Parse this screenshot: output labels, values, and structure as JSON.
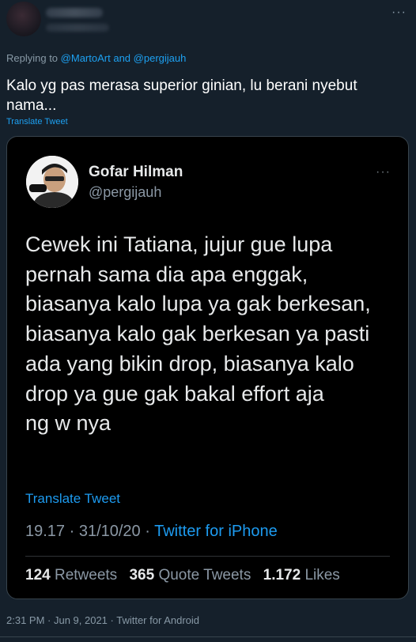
{
  "reply": {
    "replying_prefix": "Replying to",
    "mention_1": "@MartoArt",
    "and_word": "and",
    "mention_2": "@pergijauh",
    "text": "Kalo yg pas merasa superior ginian, lu berani nyebut nama...",
    "translate_label": "Translate Tweet",
    "timestamp": "2:31 PM · Jun 9, 2021 · Twitter for Android",
    "more_icon": "more-horizontal-icon"
  },
  "embedded": {
    "name": "Gofar Hilman",
    "handle": "@pergijauh",
    "text": "Cewek ini Tatiana, jujur gue lupa\npernah sama dia apa enggak,\nbiasanya kalo lupa ya gak berkesan,\nbiasanya kalo gak berkesan ya pasti\nada yang bikin drop, biasanya kalo\ndrop ya gue gak bakal effort aja\nng  w  nya",
    "translate_label": "Translate Tweet",
    "time": "19.17 · 31/10/20 · ",
    "source": "Twitter for iPhone",
    "retweets_count": "124",
    "retweets_label": "Retweets",
    "quotes_count": "365",
    "quotes_label": "Quote Tweets",
    "likes_count": "1.172",
    "likes_label": "Likes"
  },
  "colors": {
    "background": "#15202b",
    "accent": "#1da1f2",
    "muted": "#8899a6",
    "card_background": "#000000"
  }
}
